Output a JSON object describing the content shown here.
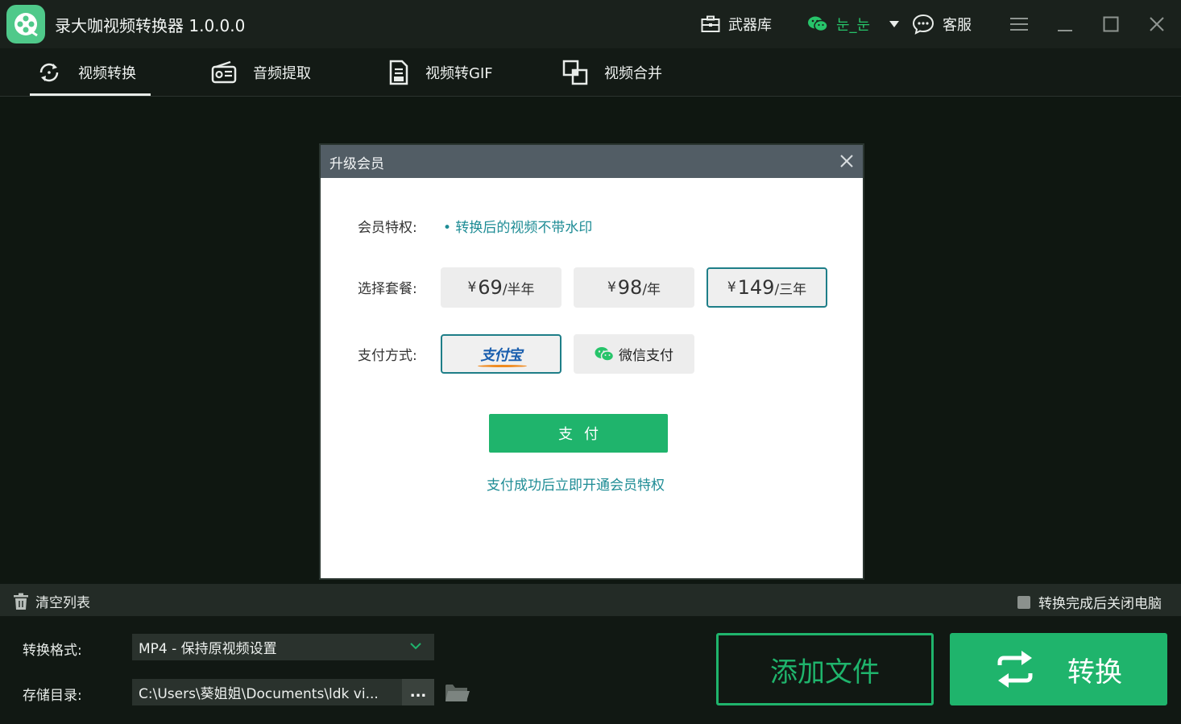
{
  "app": {
    "title": "录大咖视频转换器  1.0.0.0",
    "armory_label": "武器库",
    "wechat_user": "눈_눈",
    "service_label": "客服"
  },
  "tabs": [
    {
      "label": "视频转换",
      "icon": "convert-icon",
      "active": true
    },
    {
      "label": "音频提取",
      "icon": "radio-icon",
      "active": false
    },
    {
      "label": "视频转GIF",
      "icon": "document-icon",
      "active": false
    },
    {
      "label": "视频合并",
      "icon": "merge-icon",
      "active": false
    }
  ],
  "dialog": {
    "title": "升级会员",
    "privilege_label": "会员特权:",
    "privilege_text": "• 转换后的视频不带水印",
    "plan_label": "选择套餐:",
    "plans": [
      {
        "currency": "¥",
        "price": "69",
        "unit": "/半年",
        "selected": false
      },
      {
        "currency": "¥",
        "price": "98",
        "unit": "/年",
        "selected": false
      },
      {
        "currency": "¥",
        "price": "149",
        "unit": "/三年",
        "selected": true
      }
    ],
    "payment_label": "支付方式:",
    "payments": [
      {
        "label": "支付宝",
        "selected": true
      },
      {
        "label": "微信支付",
        "selected": false
      }
    ],
    "pay_button": "支付",
    "pay_note": "支付成功后立即开通会员特权"
  },
  "listbar": {
    "clear_label": "清空列表",
    "shutdown_label": "转换完成后关闭电脑"
  },
  "bottom": {
    "format_label": "转换格式:",
    "format_value": "MP4 - 保持原视频设置",
    "dir_label": "存储目录:",
    "dir_value": "C:\\Users\\葵姐姐\\Documents\\ldk vi...",
    "browse_label": "...",
    "add_button": "添加文件",
    "convert_button": "转换"
  },
  "colors": {
    "accent": "#1fb46c",
    "teal": "#1e8c95",
    "dialog_header": "#525d65"
  }
}
